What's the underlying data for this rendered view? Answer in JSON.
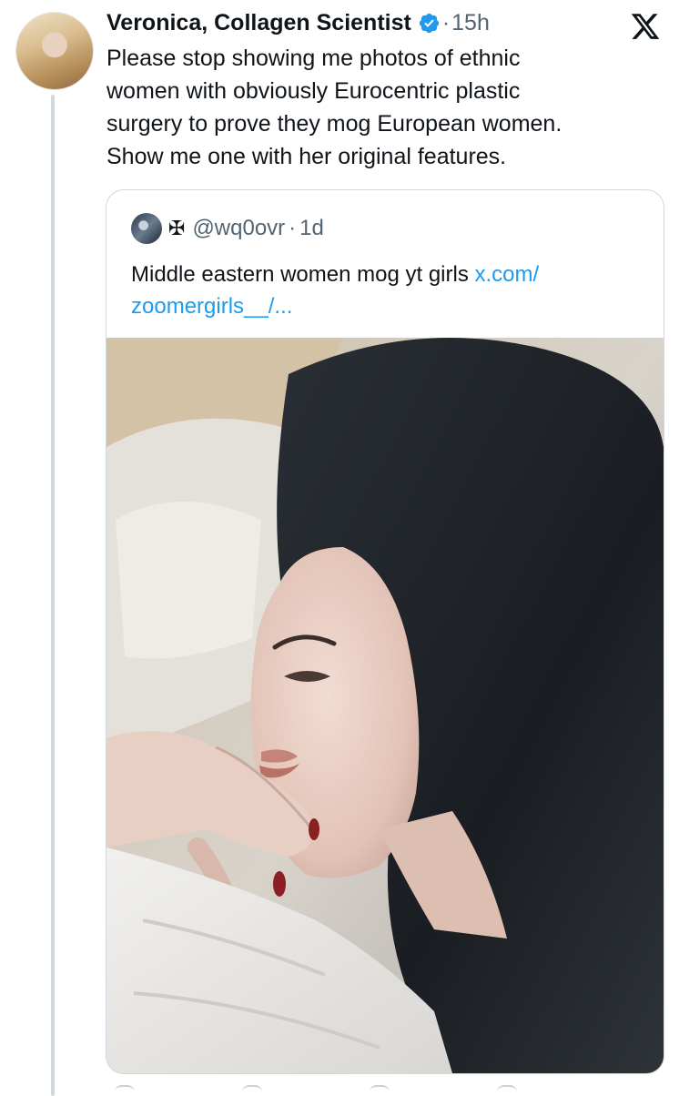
{
  "tweet": {
    "author_name": "Veronica, Collagen Scientist",
    "separator": "·",
    "time": "15h",
    "text_lines": [
      "Please stop showing me photos of ethnic",
      "women with obviously Eurocentric plastic",
      "surgery to prove they mog European women.",
      "Show me one with her original features."
    ],
    "verified_icon": "verified-badge-icon",
    "brand_icon": "x-logo-icon"
  },
  "quoted_tweet": {
    "symbol": "✠",
    "handle": "@wq0ovr",
    "separator": "·",
    "time": "1d",
    "text": "Middle eastern women mog yt girls",
    "link_line1": "x.com/",
    "link_line2": "zoomergirls__/...",
    "media_icon": "photo-woman-in-bed"
  },
  "colors": {
    "link": "#1d9bf0",
    "verified": "#1d9bf0",
    "secondary_text": "#536471",
    "border": "#cfd9de"
  }
}
